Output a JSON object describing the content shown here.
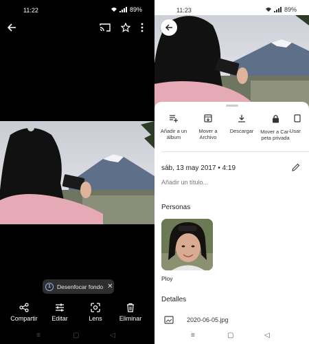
{
  "left": {
    "status": {
      "time": "11:22",
      "battery": "89%"
    },
    "toolbar": {
      "back_icon": "arrow-left-icon",
      "cast_icon": "cast-icon",
      "star_icon": "star-icon",
      "more_icon": "more-vert-icon"
    },
    "chip": {
      "label": "Desenfocar fondo"
    },
    "actions": [
      {
        "label": "Compartir",
        "icon": "share-icon"
      },
      {
        "label": "Editar",
        "icon": "tune-icon"
      },
      {
        "label": "Lens",
        "icon": "lens-icon"
      },
      {
        "label": "Eliminar",
        "icon": "trash-icon"
      }
    ]
  },
  "right": {
    "status": {
      "time": "11:23",
      "battery": "89%"
    },
    "actions": [
      {
        "label_line1": "Añadir a un",
        "label_line2": "álbum",
        "icon": "playlist-add-icon"
      },
      {
        "label_line1": "Mover a",
        "label_line2": "Archivo",
        "icon": "archive-icon"
      },
      {
        "label_line1": "Descargar",
        "label_line2": "",
        "icon": "download-icon"
      },
      {
        "label_line1": "Mover a Car-",
        "label_line2": "peta privada",
        "icon": "lock-icon"
      },
      {
        "label_line1": "Usar",
        "label_line2": "",
        "icon": "use-icon"
      }
    ],
    "date": "sáb, 13 may 2017 • 4:19",
    "title_placeholder": "Añadir un título...",
    "people_heading": "Personas",
    "person_name": "Ploy",
    "details_heading": "Detalles",
    "file_name": "2020-06-05.jpg"
  }
}
